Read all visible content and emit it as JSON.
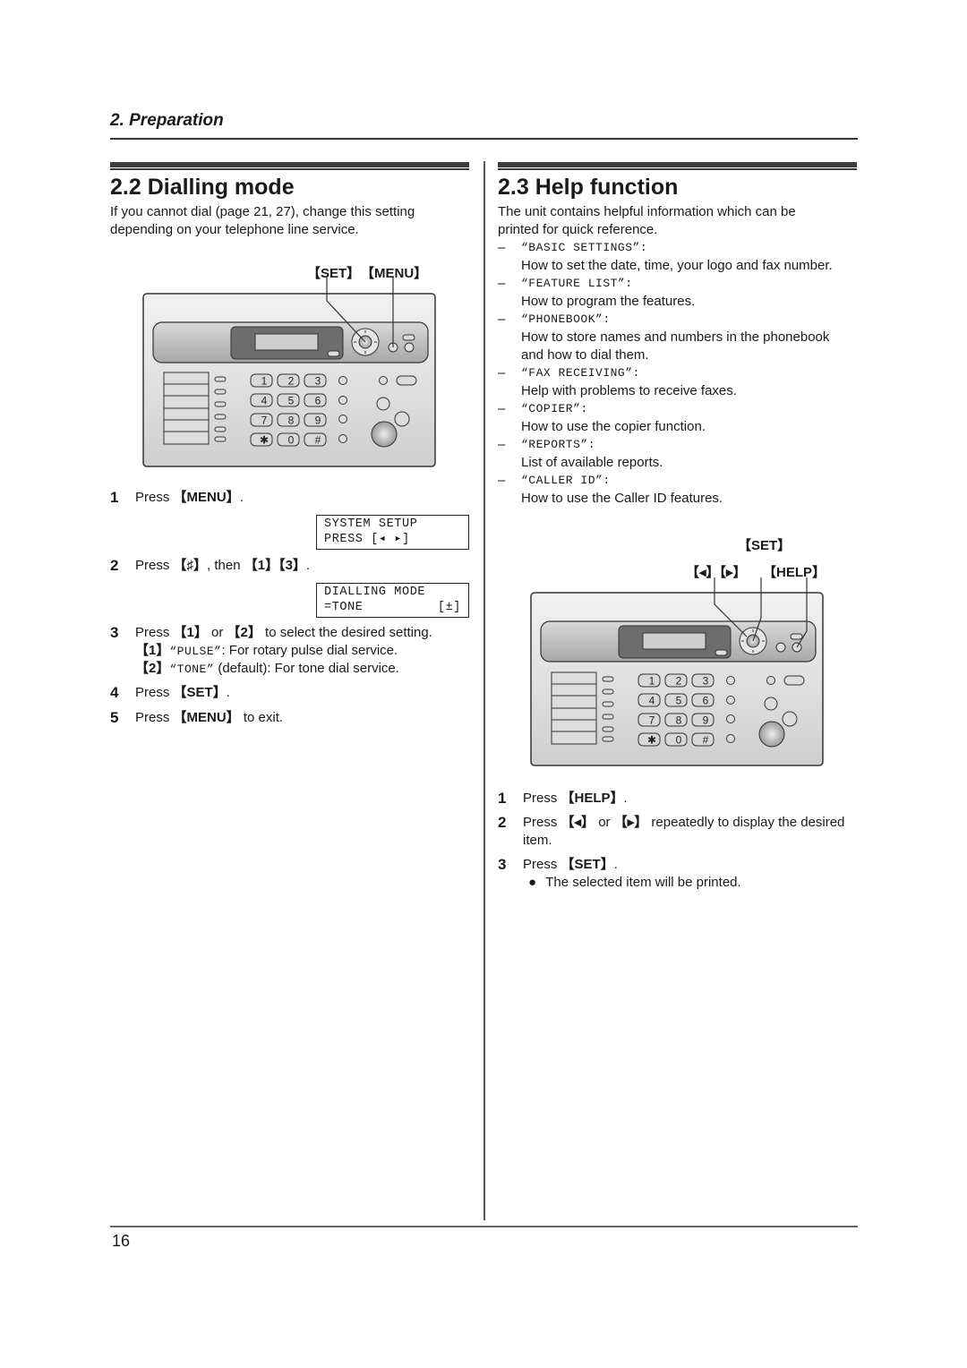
{
  "page": {
    "section_header": "2. Preparation",
    "page_number": "16"
  },
  "dialling_mode": {
    "title": "2.2 Dialling mode",
    "intro_line1": "If you cannot dial (page 21, 27), change this setting",
    "intro_line2": "depending on your telephone line service.",
    "callout_set": "【SET】",
    "callout_menu": "【MENU】",
    "steps": [
      {
        "num": "1",
        "prefix": "Press ",
        "key": "【MENU】",
        "suffix": "."
      },
      {
        "num": "2",
        "prefix": "Press ",
        "key": "【♯】",
        "middle": ", then ",
        "key2": "【1】【3】",
        "suffix": "."
      },
      {
        "num": "3",
        "prefix": "Press ",
        "key": "【1】",
        "middle": " or ",
        "key2": "【2】",
        "suffix": " to select the desired setting."
      },
      {
        "num": "4",
        "prefix": "Press ",
        "key": "【SET】",
        "suffix": "."
      },
      {
        "num": "5",
        "prefix": "Press ",
        "key": "【MENU】",
        "suffix": " to exit."
      }
    ],
    "options": [
      {
        "key": "【1】",
        "value": "“PULSE”",
        "desc": ": For rotary pulse dial service."
      },
      {
        "key": "【2】",
        "value": "“TONE”",
        "desc": " (default): For tone dial service."
      }
    ],
    "lcd1": {
      "line1": "SYSTEM SETUP",
      "line2": "PRESS [◂ ▸]"
    },
    "lcd2": {
      "line1": "DIALLING MODE",
      "line2_left": "=TONE",
      "line2_right": "[±]"
    }
  },
  "help_function": {
    "title": "2.3 Help function",
    "intro_line1": "The unit contains helpful information which can be",
    "intro_line2": "printed for quick reference.",
    "items": [
      {
        "dash": "–",
        "name": "“BASIC SETTINGS”:",
        "desc": [
          "How to set the date, time, your logo and fax number."
        ]
      },
      {
        "dash": "–",
        "name": "“FEATURE LIST”:",
        "desc": [
          "How to program the features."
        ]
      },
      {
        "dash": "–",
        "name": "“PHONEBOOK”:",
        "desc": [
          "How to store names and numbers in the phonebook",
          "and how to dial them."
        ]
      },
      {
        "dash": "–",
        "name": "“FAX RECEIVING”:",
        "desc": [
          "Help with problems to receive faxes."
        ]
      },
      {
        "dash": "–",
        "name": "“COPIER”:",
        "desc": [
          "How to use the copier function."
        ]
      },
      {
        "dash": "–",
        "name": "“REPORTS”:",
        "desc": [
          "List of available reports."
        ]
      },
      {
        "dash": "–",
        "name": "“CALLER ID”:",
        "desc": [
          "How to use the Caller ID features."
        ]
      }
    ],
    "callout_set": "【SET】",
    "callout_arrows": "【◂】【▸】",
    "callout_help": "【HELP】",
    "steps": [
      {
        "num": "1",
        "prefix": "Press ",
        "key": "【HELP】",
        "suffix": "."
      },
      {
        "num": "2",
        "prefix": "Press ",
        "key": "【◂】",
        "middle": " or ",
        "key2": "【▸】",
        "suffix": " repeatedly to display the desired",
        "line2": "item."
      },
      {
        "num": "3",
        "prefix": "Press ",
        "key": "【SET】",
        "suffix": "."
      }
    ],
    "bullet": "The selected item will be printed."
  },
  "device": {
    "keypad": [
      "1",
      "2",
      "3",
      "4",
      "5",
      "6",
      "7",
      "8",
      "9",
      "✱",
      "0",
      "#"
    ]
  }
}
